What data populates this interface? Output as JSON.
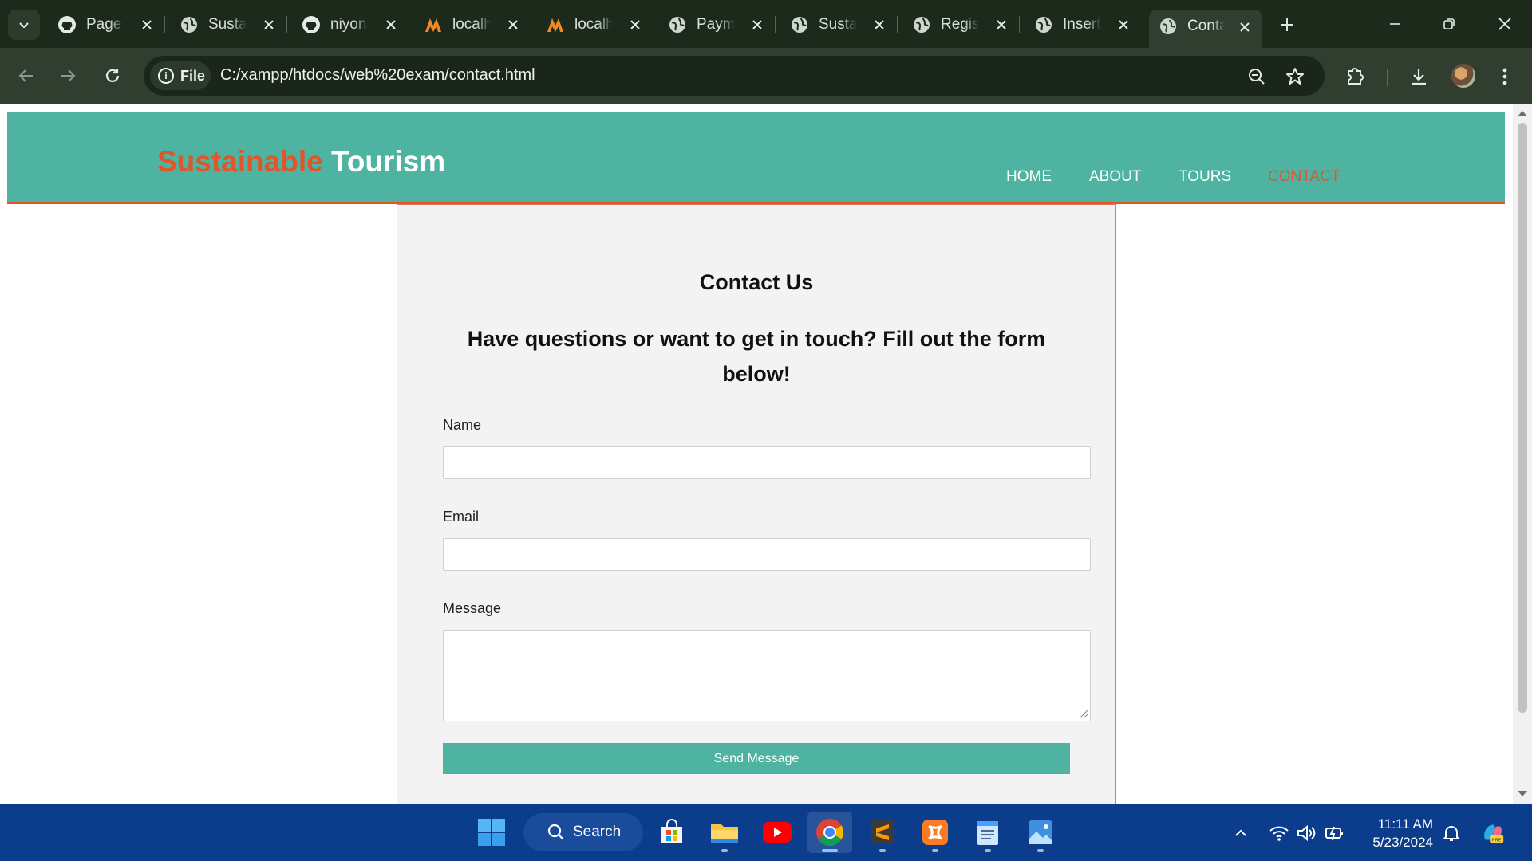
{
  "browser": {
    "tabs": [
      {
        "title": "Page r",
        "icon": "github-icon"
      },
      {
        "title": "Susta",
        "icon": "globe-icon"
      },
      {
        "title": "niyon.",
        "icon": "github-icon"
      },
      {
        "title": "localh",
        "icon": "xampp-icon"
      },
      {
        "title": "localh",
        "icon": "xampp-icon"
      },
      {
        "title": "Paym",
        "icon": "globe-icon"
      },
      {
        "title": "Susta",
        "icon": "globe-icon"
      },
      {
        "title": "Regist",
        "icon": "globe-icon"
      },
      {
        "title": "Insert",
        "icon": "globe-icon"
      },
      {
        "title": "Conta",
        "icon": "globe-icon",
        "active": true
      }
    ],
    "site_chip_label": "File",
    "url": "C:/xampp/htdocs/web%20exam/contact.html"
  },
  "page": {
    "logo_accent": "Sustainable",
    "logo_rest": "Tourism",
    "nav": [
      {
        "label": "HOME"
      },
      {
        "label": "ABOUT"
      },
      {
        "label": "TOURS"
      },
      {
        "label": "CONTACT",
        "active": true
      }
    ],
    "contact": {
      "title": "Contact Us",
      "subtitle": "Have questions or want to get in touch? Fill out the form below!",
      "name_label": "Name",
      "name_value": "",
      "email_label": "Email",
      "email_value": "",
      "message_label": "Message",
      "message_value": "",
      "send_label": "Send Message"
    },
    "colors": {
      "header": "#4fb3a1",
      "accent": "#e0552a",
      "form_bg": "#f3f3f3"
    }
  },
  "taskbar": {
    "search_label": "Search",
    "time": "11:11 AM",
    "date": "5/23/2024",
    "pinned": [
      "windows-start-icon",
      "microsoft-store-icon",
      "file-explorer-icon",
      "youtube-icon",
      "chrome-icon",
      "sublime-text-icon",
      "xampp-icon",
      "notepad-icon",
      "photos-icon"
    ]
  }
}
